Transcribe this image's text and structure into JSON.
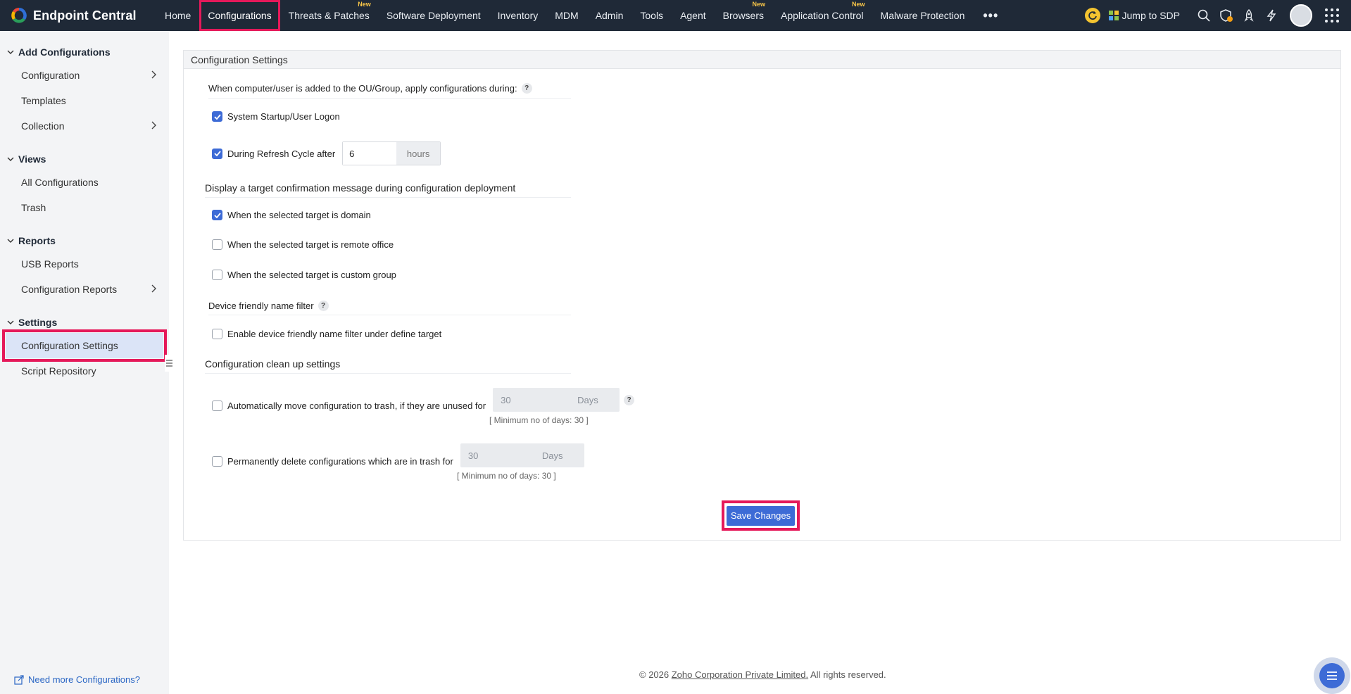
{
  "app": {
    "name": "Endpoint Central"
  },
  "nav": {
    "items": [
      {
        "label": "Home",
        "new": ""
      },
      {
        "label": "Configurations",
        "new": ""
      },
      {
        "label": "Threats & Patches",
        "new": "New"
      },
      {
        "label": "Software Deployment",
        "new": ""
      },
      {
        "label": "Inventory",
        "new": ""
      },
      {
        "label": "MDM",
        "new": ""
      },
      {
        "label": "Admin",
        "new": ""
      },
      {
        "label": "Tools",
        "new": ""
      },
      {
        "label": "Agent",
        "new": ""
      },
      {
        "label": "Browsers",
        "new": "New"
      },
      {
        "label": "Application Control",
        "new": "New"
      },
      {
        "label": "Malware Protection",
        "new": ""
      }
    ],
    "more": "•••",
    "active": "Configurations"
  },
  "topbar": {
    "jump_sdp": "Jump to SDP"
  },
  "sidebar": {
    "sections": [
      {
        "title": "Add Configurations",
        "items": [
          {
            "label": "Configuration"
          },
          {
            "label": "Templates"
          },
          {
            "label": "Collection"
          }
        ]
      },
      {
        "title": "Views",
        "items": [
          {
            "label": "All Configurations"
          },
          {
            "label": "Trash"
          }
        ]
      },
      {
        "title": "Reports",
        "items": [
          {
            "label": "USB Reports"
          },
          {
            "label": "Configuration Reports"
          }
        ]
      },
      {
        "title": "Settings",
        "items": [
          {
            "label": "Configuration Settings"
          },
          {
            "label": "Script Repository"
          }
        ]
      }
    ],
    "footer_link": "Need more Configurations?"
  },
  "panel": {
    "title": "Configuration Settings",
    "ou_heading": "When computer/user is added to the OU/Group, apply configurations during:",
    "startup_label": "System Startup/User Logon",
    "startup_checked": true,
    "refresh_label": "During Refresh Cycle after",
    "refresh_checked": true,
    "refresh_value": "6",
    "refresh_unit": "hours",
    "confirm_heading": "Display a target confirmation message during configuration deployment",
    "domain_label": "When the selected target is domain",
    "domain_checked": true,
    "remote_label": "When the selected target is remote office",
    "remote_checked": false,
    "custom_label": "When the selected target is custom group",
    "custom_checked": false,
    "friendly_heading": "Device friendly name filter",
    "friendly_label": "Enable device friendly name filter under define target",
    "friendly_checked": false,
    "cleanup_heading": "Configuration clean up settings",
    "auto_trash_label": "Automatically move configuration to trash, if they are unused for",
    "auto_trash_checked": false,
    "auto_trash_value": "30",
    "auto_trash_unit": "Days",
    "auto_trash_hint": "[ Minimum no of days: 30 ]",
    "perm_delete_label": "Permanently delete configurations which are in trash for",
    "perm_delete_checked": false,
    "perm_delete_value": "30",
    "perm_delete_unit": "Days",
    "perm_delete_hint": "[ Minimum no of days: 30 ]",
    "help_glyph": "?",
    "save_label": "Save Changes"
  },
  "footer": {
    "prefix": "© 2026 ",
    "company": "Zoho Corporation Private Limited.",
    "suffix": " All rights reserved."
  },
  "colors": {
    "accent": "#3d6bd6",
    "highlight": "#e5195a",
    "topbar": "#1f2937"
  }
}
